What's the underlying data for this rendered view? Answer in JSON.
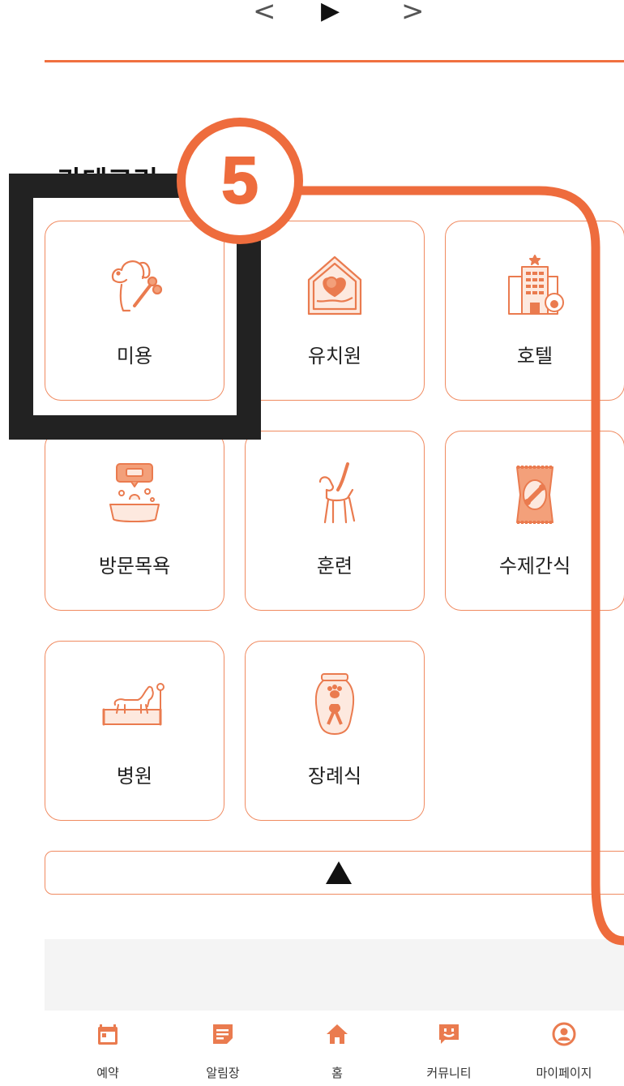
{
  "top_nav": {
    "prev": "<",
    "play": "▶",
    "next": ">"
  },
  "section": {
    "title": "카테고리"
  },
  "categories": [
    {
      "label": "미용",
      "icon": "dog-grooming-icon"
    },
    {
      "label": "유치원",
      "icon": "pet-kindergarten-icon"
    },
    {
      "label": "호텔",
      "icon": "pet-hotel-icon"
    },
    {
      "label": "방문목욕",
      "icon": "visit-bath-icon"
    },
    {
      "label": "훈련",
      "icon": "dog-training-icon"
    },
    {
      "label": "수제간식",
      "icon": "handmade-treat-icon"
    },
    {
      "label": "병원",
      "icon": "animal-hospital-icon"
    },
    {
      "label": "장례식",
      "icon": "pet-funeral-icon"
    }
  ],
  "collapse": {
    "icon": "collapse-up-icon"
  },
  "annotation": {
    "step": "5"
  },
  "tab_bar": [
    {
      "label": "예약",
      "icon": "calendar-icon"
    },
    {
      "label": "알림장",
      "icon": "notebook-icon"
    },
    {
      "label": "홈",
      "icon": "home-icon"
    },
    {
      "label": "커뮤니티",
      "icon": "chat-icon"
    },
    {
      "label": "마이페이지",
      "icon": "profile-icon"
    }
  ],
  "colors": {
    "accent": "#f0703f",
    "card_border": "#f08a60",
    "frame": "#222222"
  }
}
